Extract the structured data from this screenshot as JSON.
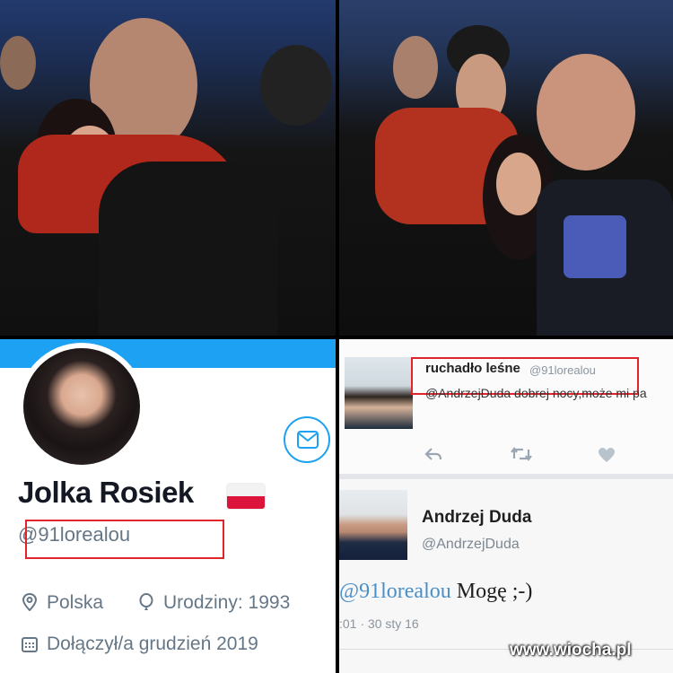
{
  "profile": {
    "name": "Jolka Rosiek",
    "handle": "@91lorealou",
    "location": "Polska",
    "birthday": "Urodziny: 1993",
    "joined": "Dołączył/a grudzień 2019"
  },
  "tweet_top": {
    "name": "ruchadło leśne",
    "handle": "@91lorealou",
    "text": "@AndrzejDuda dobrej nocy,może mi pa"
  },
  "tweet_reply": {
    "name": "Andrzej Duda",
    "handle": "@AndrzejDuda",
    "mention": "@91lorealou",
    "text": "Mogę ;-)",
    "time": ":01 · 30 sty 16"
  },
  "watermark": "www.wiocha.pl",
  "colors": {
    "twitter_blue": "#1da1f2",
    "highlight_red": "#e0242b"
  }
}
